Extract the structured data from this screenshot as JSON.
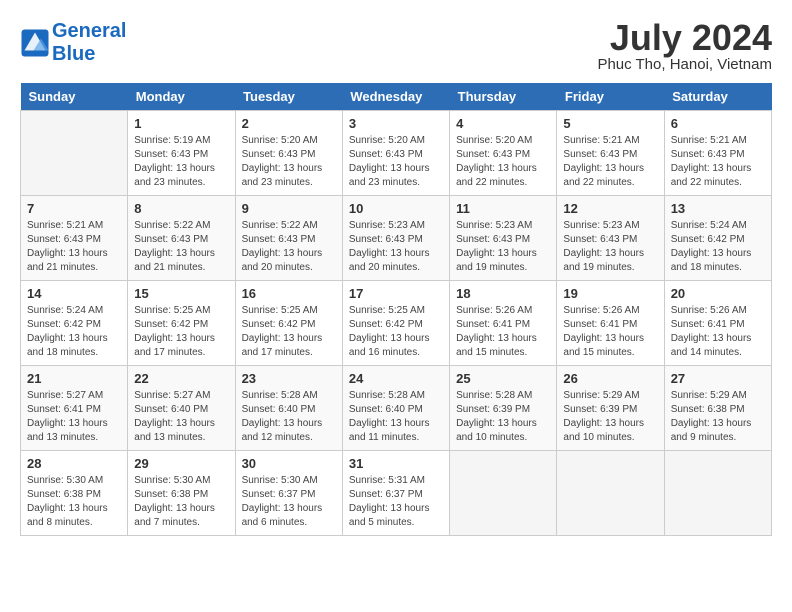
{
  "header": {
    "logo_line1": "General",
    "logo_line2": "Blue",
    "month": "July 2024",
    "location": "Phuc Tho, Hanoi, Vietnam"
  },
  "weekdays": [
    "Sunday",
    "Monday",
    "Tuesday",
    "Wednesday",
    "Thursday",
    "Friday",
    "Saturday"
  ],
  "weeks": [
    [
      {
        "day": "",
        "sunrise": "",
        "sunset": "",
        "daylight": ""
      },
      {
        "day": "1",
        "sunrise": "Sunrise: 5:19 AM",
        "sunset": "Sunset: 6:43 PM",
        "daylight": "Daylight: 13 hours and 23 minutes."
      },
      {
        "day": "2",
        "sunrise": "Sunrise: 5:20 AM",
        "sunset": "Sunset: 6:43 PM",
        "daylight": "Daylight: 13 hours and 23 minutes."
      },
      {
        "day": "3",
        "sunrise": "Sunrise: 5:20 AM",
        "sunset": "Sunset: 6:43 PM",
        "daylight": "Daylight: 13 hours and 23 minutes."
      },
      {
        "day": "4",
        "sunrise": "Sunrise: 5:20 AM",
        "sunset": "Sunset: 6:43 PM",
        "daylight": "Daylight: 13 hours and 22 minutes."
      },
      {
        "day": "5",
        "sunrise": "Sunrise: 5:21 AM",
        "sunset": "Sunset: 6:43 PM",
        "daylight": "Daylight: 13 hours and 22 minutes."
      },
      {
        "day": "6",
        "sunrise": "Sunrise: 5:21 AM",
        "sunset": "Sunset: 6:43 PM",
        "daylight": "Daylight: 13 hours and 22 minutes."
      }
    ],
    [
      {
        "day": "7",
        "sunrise": "Sunrise: 5:21 AM",
        "sunset": "Sunset: 6:43 PM",
        "daylight": "Daylight: 13 hours and 21 minutes."
      },
      {
        "day": "8",
        "sunrise": "Sunrise: 5:22 AM",
        "sunset": "Sunset: 6:43 PM",
        "daylight": "Daylight: 13 hours and 21 minutes."
      },
      {
        "day": "9",
        "sunrise": "Sunrise: 5:22 AM",
        "sunset": "Sunset: 6:43 PM",
        "daylight": "Daylight: 13 hours and 20 minutes."
      },
      {
        "day": "10",
        "sunrise": "Sunrise: 5:23 AM",
        "sunset": "Sunset: 6:43 PM",
        "daylight": "Daylight: 13 hours and 20 minutes."
      },
      {
        "day": "11",
        "sunrise": "Sunrise: 5:23 AM",
        "sunset": "Sunset: 6:43 PM",
        "daylight": "Daylight: 13 hours and 19 minutes."
      },
      {
        "day": "12",
        "sunrise": "Sunrise: 5:23 AM",
        "sunset": "Sunset: 6:43 PM",
        "daylight": "Daylight: 13 hours and 19 minutes."
      },
      {
        "day": "13",
        "sunrise": "Sunrise: 5:24 AM",
        "sunset": "Sunset: 6:42 PM",
        "daylight": "Daylight: 13 hours and 18 minutes."
      }
    ],
    [
      {
        "day": "14",
        "sunrise": "Sunrise: 5:24 AM",
        "sunset": "Sunset: 6:42 PM",
        "daylight": "Daylight: 13 hours and 18 minutes."
      },
      {
        "day": "15",
        "sunrise": "Sunrise: 5:25 AM",
        "sunset": "Sunset: 6:42 PM",
        "daylight": "Daylight: 13 hours and 17 minutes."
      },
      {
        "day": "16",
        "sunrise": "Sunrise: 5:25 AM",
        "sunset": "Sunset: 6:42 PM",
        "daylight": "Daylight: 13 hours and 17 minutes."
      },
      {
        "day": "17",
        "sunrise": "Sunrise: 5:25 AM",
        "sunset": "Sunset: 6:42 PM",
        "daylight": "Daylight: 13 hours and 16 minutes."
      },
      {
        "day": "18",
        "sunrise": "Sunrise: 5:26 AM",
        "sunset": "Sunset: 6:41 PM",
        "daylight": "Daylight: 13 hours and 15 minutes."
      },
      {
        "day": "19",
        "sunrise": "Sunrise: 5:26 AM",
        "sunset": "Sunset: 6:41 PM",
        "daylight": "Daylight: 13 hours and 15 minutes."
      },
      {
        "day": "20",
        "sunrise": "Sunrise: 5:26 AM",
        "sunset": "Sunset: 6:41 PM",
        "daylight": "Daylight: 13 hours and 14 minutes."
      }
    ],
    [
      {
        "day": "21",
        "sunrise": "Sunrise: 5:27 AM",
        "sunset": "Sunset: 6:41 PM",
        "daylight": "Daylight: 13 hours and 13 minutes."
      },
      {
        "day": "22",
        "sunrise": "Sunrise: 5:27 AM",
        "sunset": "Sunset: 6:40 PM",
        "daylight": "Daylight: 13 hours and 13 minutes."
      },
      {
        "day": "23",
        "sunrise": "Sunrise: 5:28 AM",
        "sunset": "Sunset: 6:40 PM",
        "daylight": "Daylight: 13 hours and 12 minutes."
      },
      {
        "day": "24",
        "sunrise": "Sunrise: 5:28 AM",
        "sunset": "Sunset: 6:40 PM",
        "daylight": "Daylight: 13 hours and 11 minutes."
      },
      {
        "day": "25",
        "sunrise": "Sunrise: 5:28 AM",
        "sunset": "Sunset: 6:39 PM",
        "daylight": "Daylight: 13 hours and 10 minutes."
      },
      {
        "day": "26",
        "sunrise": "Sunrise: 5:29 AM",
        "sunset": "Sunset: 6:39 PM",
        "daylight": "Daylight: 13 hours and 10 minutes."
      },
      {
        "day": "27",
        "sunrise": "Sunrise: 5:29 AM",
        "sunset": "Sunset: 6:38 PM",
        "daylight": "Daylight: 13 hours and 9 minutes."
      }
    ],
    [
      {
        "day": "28",
        "sunrise": "Sunrise: 5:30 AM",
        "sunset": "Sunset: 6:38 PM",
        "daylight": "Daylight: 13 hours and 8 minutes."
      },
      {
        "day": "29",
        "sunrise": "Sunrise: 5:30 AM",
        "sunset": "Sunset: 6:38 PM",
        "daylight": "Daylight: 13 hours and 7 minutes."
      },
      {
        "day": "30",
        "sunrise": "Sunrise: 5:30 AM",
        "sunset": "Sunset: 6:37 PM",
        "daylight": "Daylight: 13 hours and 6 minutes."
      },
      {
        "day": "31",
        "sunrise": "Sunrise: 5:31 AM",
        "sunset": "Sunset: 6:37 PM",
        "daylight": "Daylight: 13 hours and 5 minutes."
      },
      {
        "day": "",
        "sunrise": "",
        "sunset": "",
        "daylight": ""
      },
      {
        "day": "",
        "sunrise": "",
        "sunset": "",
        "daylight": ""
      },
      {
        "day": "",
        "sunrise": "",
        "sunset": "",
        "daylight": ""
      }
    ]
  ]
}
